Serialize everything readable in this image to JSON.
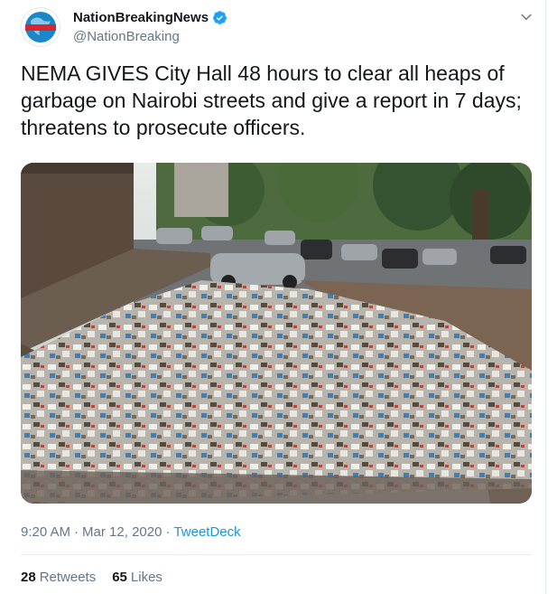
{
  "author": {
    "display_name": "NationBreakingNews",
    "handle": "@NationBreaking",
    "verified": true,
    "avatar_text": "BREAKING NEWS"
  },
  "tweet": {
    "text": "NEMA GIVES City Hall 48 hours to clear all heaps of garbage on Nairobi streets and give a report in 7 days; threatens to prosecute officers."
  },
  "meta": {
    "time": "9:20 AM",
    "separator": "·",
    "date": "Mar 12, 2020",
    "source": "TweetDeck"
  },
  "stats": {
    "retweets_count": "28",
    "retweets_label": "Retweets",
    "likes_count": "65",
    "likes_label": "Likes"
  },
  "colors": {
    "link": "#1b95e0",
    "secondary_text": "#657786",
    "verified_badge": "#1da1f2"
  },
  "icons": {
    "verified": "verified-badge-icon",
    "menu": "chevron-down-icon"
  }
}
